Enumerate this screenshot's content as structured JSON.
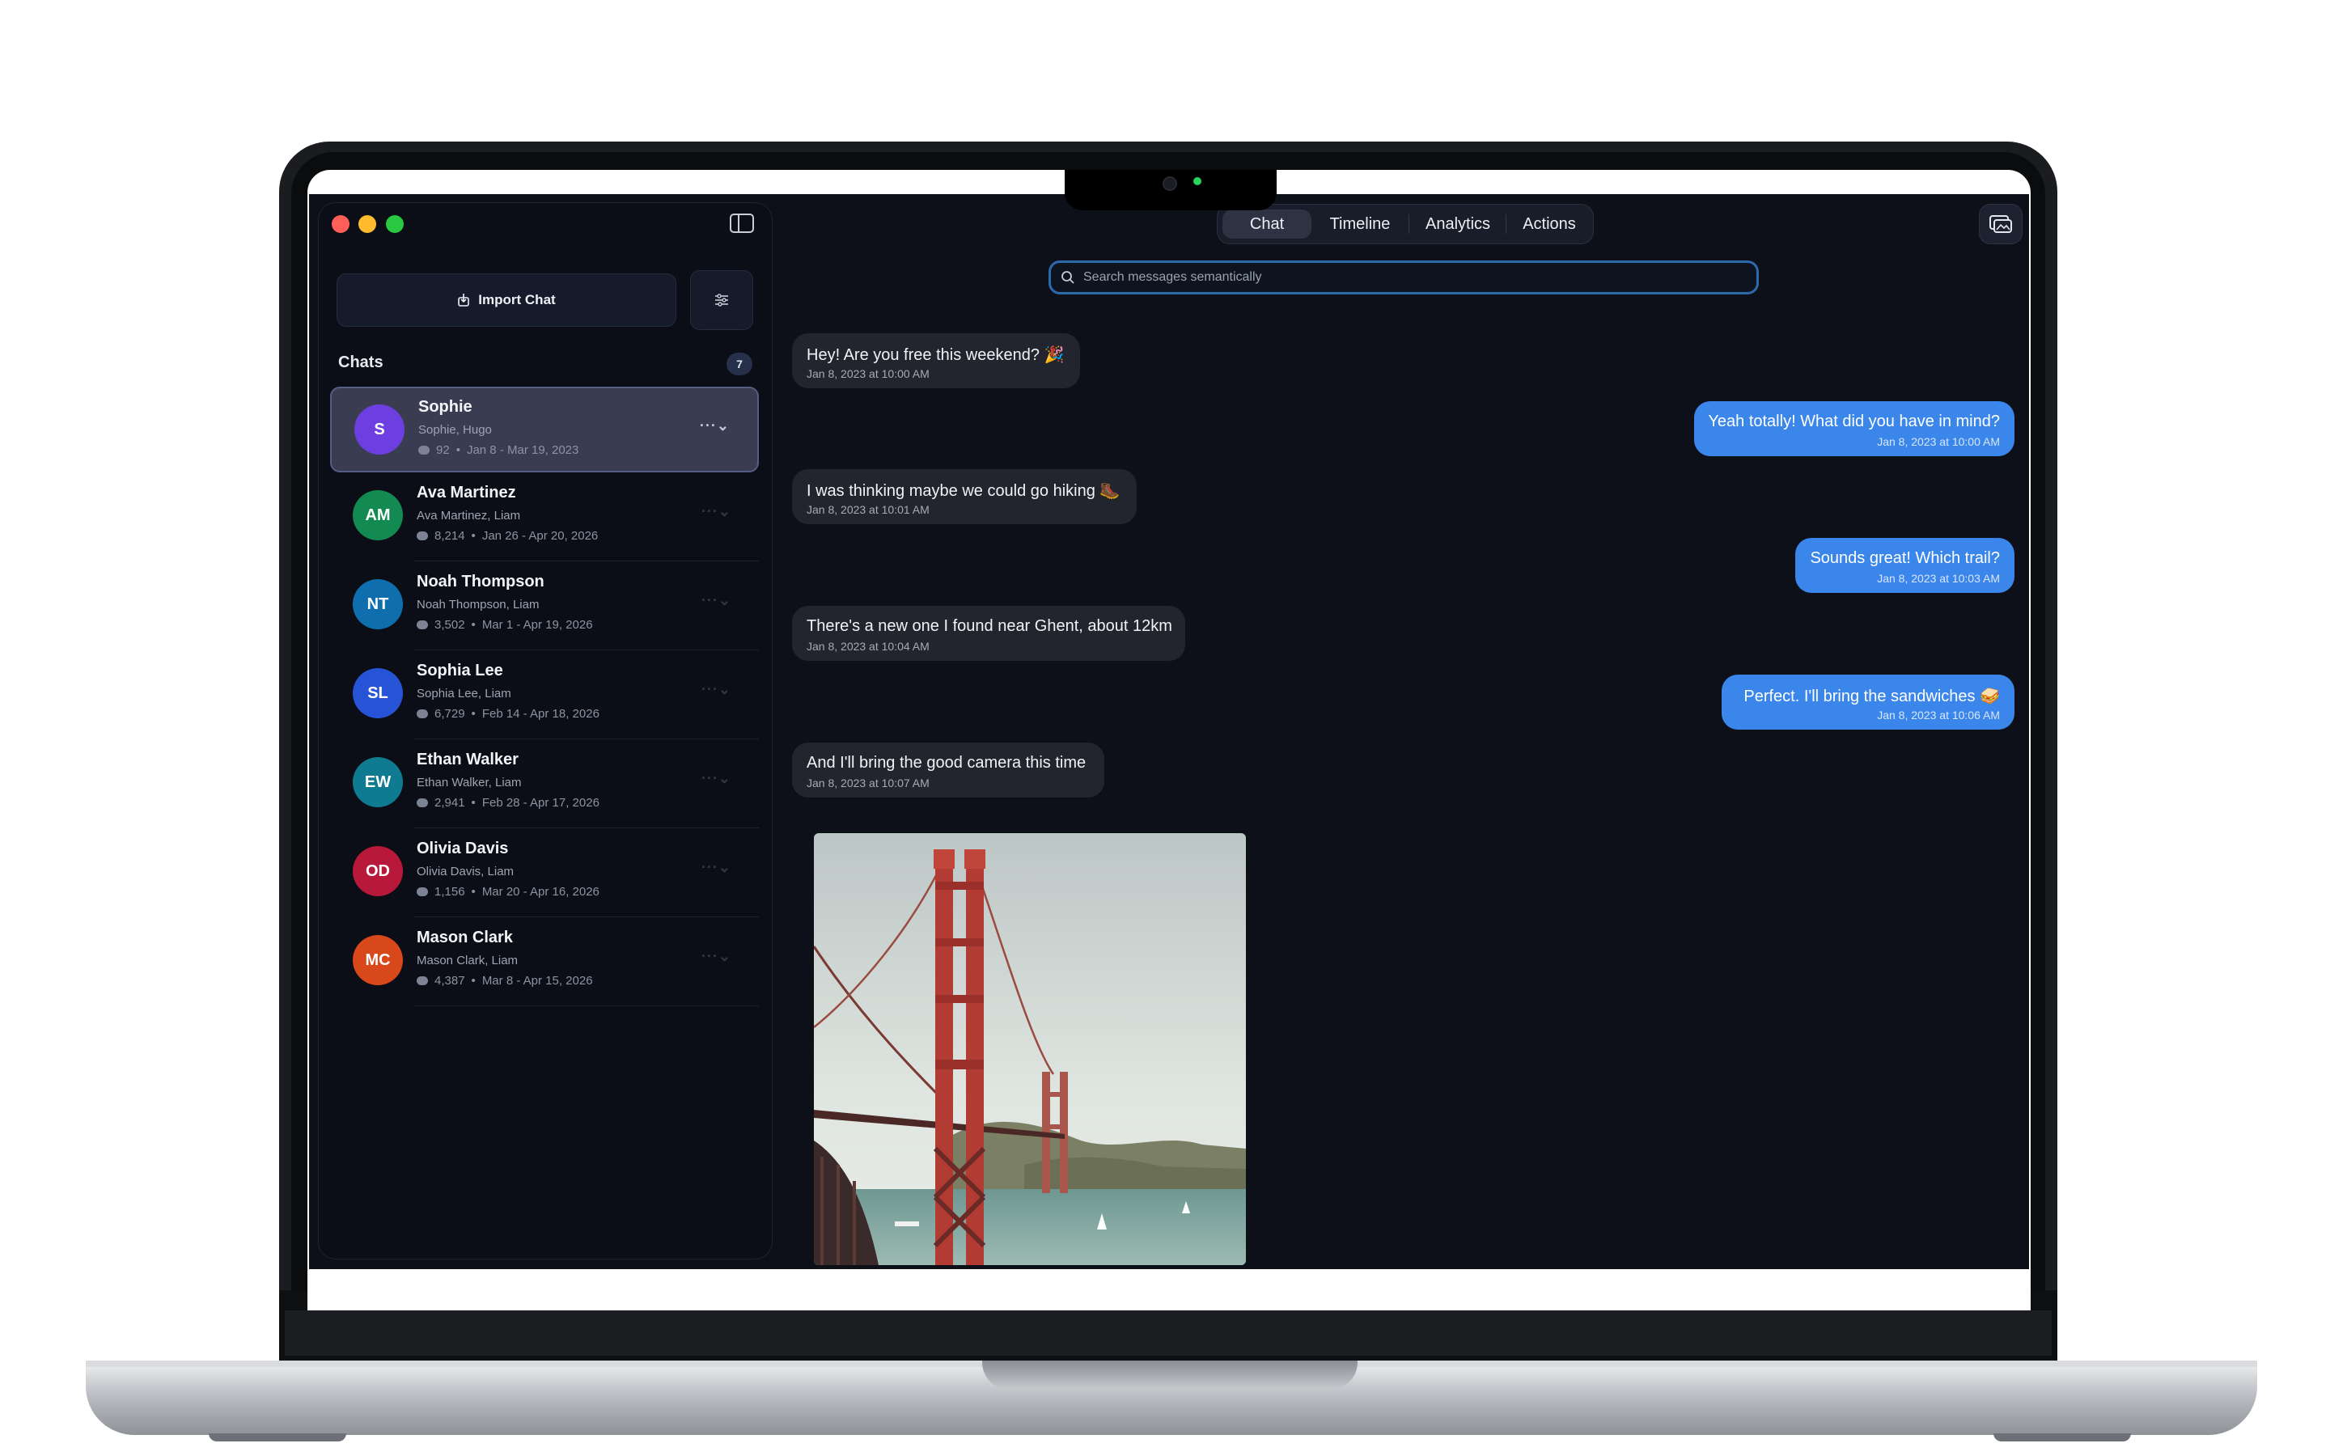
{
  "window": {
    "import_label": "Import Chat"
  },
  "sidebar": {
    "section_title": "Chats",
    "count": "7",
    "chats": [
      {
        "initials": "S",
        "name": "Sophie",
        "members": "Sophie, Hugo",
        "messages": "92",
        "range": "Jan 8 - Mar 19, 2023",
        "color": "#6d3fe0"
      },
      {
        "initials": "AM",
        "name": "Ava Martinez",
        "members": "Ava Martinez, Liam",
        "messages": "8,214",
        "range": "Jan 26 - Apr 20, 2026",
        "color": "#138a52"
      },
      {
        "initials": "NT",
        "name": "Noah Thompson",
        "members": "Noah Thompson, Liam",
        "messages": "3,502",
        "range": "Mar 1 - Apr 19, 2026",
        "color": "#0f6fae"
      },
      {
        "initials": "SL",
        "name": "Sophia Lee",
        "members": "Sophia Lee, Liam",
        "messages": "6,729",
        "range": "Feb 14 - Apr 18, 2026",
        "color": "#2753d6"
      },
      {
        "initials": "EW",
        "name": "Ethan Walker",
        "members": "Ethan Walker, Liam",
        "messages": "2,941",
        "range": "Feb 28 - Apr 17, 2026",
        "color": "#0f7b90"
      },
      {
        "initials": "OD",
        "name": "Olivia Davis",
        "members": "Olivia Davis, Liam",
        "messages": "1,156",
        "range": "Mar 20 - Apr 16, 2026",
        "color": "#b8193a"
      },
      {
        "initials": "MC",
        "name": "Mason Clark",
        "members": "Mason Clark, Liam",
        "messages": "4,387",
        "range": "Mar 8 - Apr 15, 2026",
        "color": "#d9481a"
      }
    ]
  },
  "tabs": [
    "Chat",
    "Timeline",
    "Analytics",
    "Actions"
  ],
  "active_tab": "Chat",
  "search": {
    "placeholder": "Search messages semantically"
  },
  "messages": [
    {
      "direction": "in",
      "text": "Hey! Are you free this weekend? 🎉",
      "time": "Jan 8, 2023 at 10:00 AM"
    },
    {
      "direction": "out",
      "text": "Yeah totally! What did you have in mind?",
      "time": "Jan 8, 2023 at 10:00 AM"
    },
    {
      "direction": "in",
      "text": "I was thinking maybe we could go hiking 🥾",
      "time": "Jan 8, 2023 at 10:01 AM"
    },
    {
      "direction": "out",
      "text": "Sounds great! Which trail?",
      "time": "Jan 8, 2023 at 10:03 AM"
    },
    {
      "direction": "in",
      "text": "There's a new one I found near Ghent, about 12km",
      "time": "Jan 8, 2023 at 10:04 AM"
    },
    {
      "direction": "out",
      "text": "Perfect. I'll bring the sandwiches 🥪",
      "time": "Jan 8, 2023 at 10:06 AM"
    },
    {
      "direction": "in",
      "text": "And I'll bring the good camera this time",
      "time": "Jan 8, 2023 at 10:07 AM"
    }
  ],
  "colors": {
    "accent": "#3b86ea",
    "background": "#0d1018",
    "incoming_bubble": "#22252d",
    "search_border": "#2d6aac"
  },
  "icons": {
    "import": "import-icon",
    "filter": "filter-icon",
    "sidebar_toggle": "sidebar-toggle-icon",
    "media": "photo-gallery-icon",
    "search": "search-icon"
  }
}
